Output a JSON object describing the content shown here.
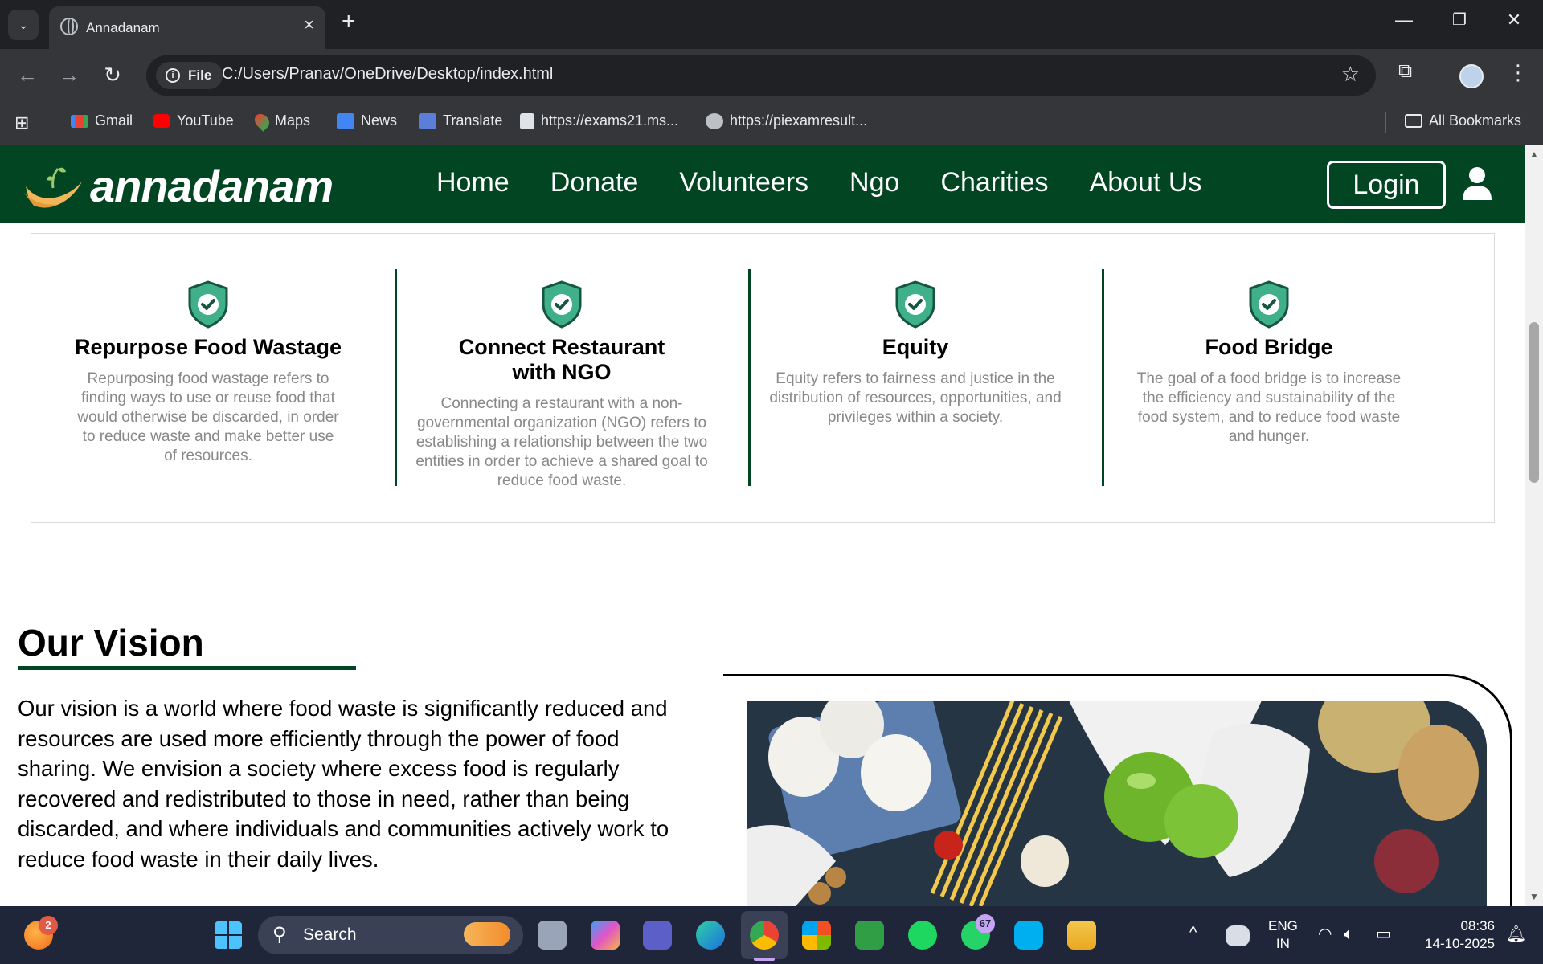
{
  "browser": {
    "tab_title": "Annadanam",
    "site_info_label": "File",
    "url": "C:/Users/Pranav/OneDrive/Desktop/index.html",
    "bookmarks": [
      "Gmail",
      "YouTube",
      "Maps",
      "News",
      "Translate",
      "https://exams21.ms...",
      "https://piexamresult..."
    ],
    "all_bookmarks": "All Bookmarks"
  },
  "site": {
    "logo": "annadanam",
    "menu": [
      "Home",
      "Donate",
      "Volunteers",
      "Ngo",
      "Charities",
      "About Us"
    ],
    "login": "Login"
  },
  "features": [
    {
      "title": "Repurpose Food Wastage",
      "text": "Repurposing food wastage refers to finding ways to use or reuse food that would otherwise be discarded, in order to reduce waste and make better use of resources."
    },
    {
      "title": "Connect Restaurant with NGO",
      "text": "Connecting a restaurant with a non-governmental organization (NGO) refers to establishing a relationship between the two entities in order to achieve a shared goal to reduce food waste."
    },
    {
      "title": "Equity",
      "text": "Equity refers to fairness and justice in the distribution of resources, opportunities, and privileges within a society."
    },
    {
      "title": "Food Bridge",
      "text": "The goal of a food bridge is to increase the efficiency and sustainability of the food system, and to reduce food waste and hunger."
    }
  ],
  "vision": {
    "title": "Our Vision",
    "text": "Our vision is a world where food waste is significantly reduced and resources are used more efficiently through the power of food sharing. We envision a society where excess food is regularly recovered and redistributed to those in need, rather than being discarded, and where individuals and communities actively work to reduce food waste in their daily lives."
  },
  "taskbar": {
    "search": "Search",
    "notification_badge": "2",
    "whatsapp_badge": "67",
    "language": "ENG",
    "region": "IN",
    "time": "08:36",
    "date": "14-10-2025"
  },
  "colors": {
    "brand_green": "#024522",
    "chrome_dark": "#202124",
    "chrome_toolbar": "#35363a"
  }
}
